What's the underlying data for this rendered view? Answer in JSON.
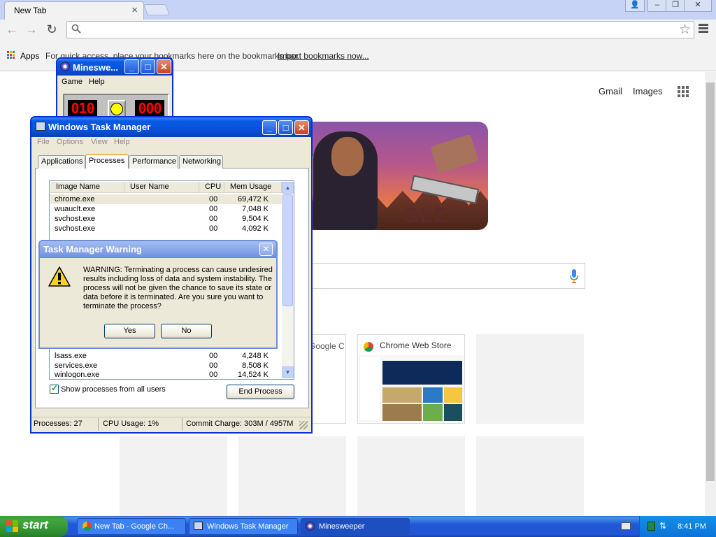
{
  "chrome": {
    "tab_title": "New Tab",
    "tab_close": "×",
    "bookmarks": {
      "apps_label": "Apps",
      "hint": "For quick access, place your bookmarks here on the bookmarks bar.",
      "import_link": "Import bookmarks now..."
    },
    "newtab": {
      "gmail": "Gmail",
      "images": "Images",
      "doodle_text": "GLE",
      "tiles": [
        {
          "label": "Google C"
        },
        {
          "label": "Chrome Web Store"
        }
      ]
    }
  },
  "minesweeper": {
    "title": "Minesweeper",
    "title_display": "Mineswe...",
    "menu": [
      "Game",
      "Help"
    ],
    "mines_counter": "010",
    "timer": "000"
  },
  "task_manager": {
    "title": "Windows Task Manager",
    "menu": [
      "File",
      "Options",
      "View",
      "Help"
    ],
    "tabs": [
      "Applications",
      "Processes",
      "Performance",
      "Networking"
    ],
    "active_tab": "Processes",
    "columns": [
      "Image Name",
      "User Name",
      "CPU",
      "Mem Usage"
    ],
    "rows_top": [
      {
        "name": "chrome.exe",
        "cpu": "00",
        "mem": "69,472 K"
      },
      {
        "name": "wuauclt.exe",
        "cpu": "00",
        "mem": "7,048 K"
      },
      {
        "name": "svchost.exe",
        "cpu": "00",
        "mem": "9,504 K"
      },
      {
        "name": "svchost.exe",
        "cpu": "00",
        "mem": "4,092 K"
      }
    ],
    "rows_bottom": [
      {
        "name": "lsass.exe",
        "cpu": "00",
        "mem": "4,248 K"
      },
      {
        "name": "services.exe",
        "cpu": "00",
        "mem": "8,508 K"
      },
      {
        "name": "winlogon.exe",
        "cpu": "00",
        "mem": "14,524 K"
      }
    ],
    "show_all_label": "Show processes from all users",
    "end_process": "End Process",
    "status": {
      "processes": "Processes: 27",
      "cpu": "CPU Usage: 1%",
      "commit": "Commit Charge: 303M / 4957M"
    }
  },
  "warning": {
    "title": "Task Manager Warning",
    "message": "WARNING: Terminating a process can cause undesired results including loss of data and system instability. The process will not be given the chance to save its state or data before it is terminated.  Are you sure you want to terminate the process?",
    "yes": "Yes",
    "no": "No"
  },
  "taskbar": {
    "start": "start",
    "items": [
      "New Tab - Google Ch...",
      "Windows Task Manager",
      "Minesweeper"
    ],
    "clock": "8:41 PM"
  },
  "colors": {
    "xp_title_blue": "#0a5ae6",
    "taskbar_blue": "#2157d7",
    "start_green": "#3c9a3c",
    "lcd_red": "#ff0000"
  }
}
